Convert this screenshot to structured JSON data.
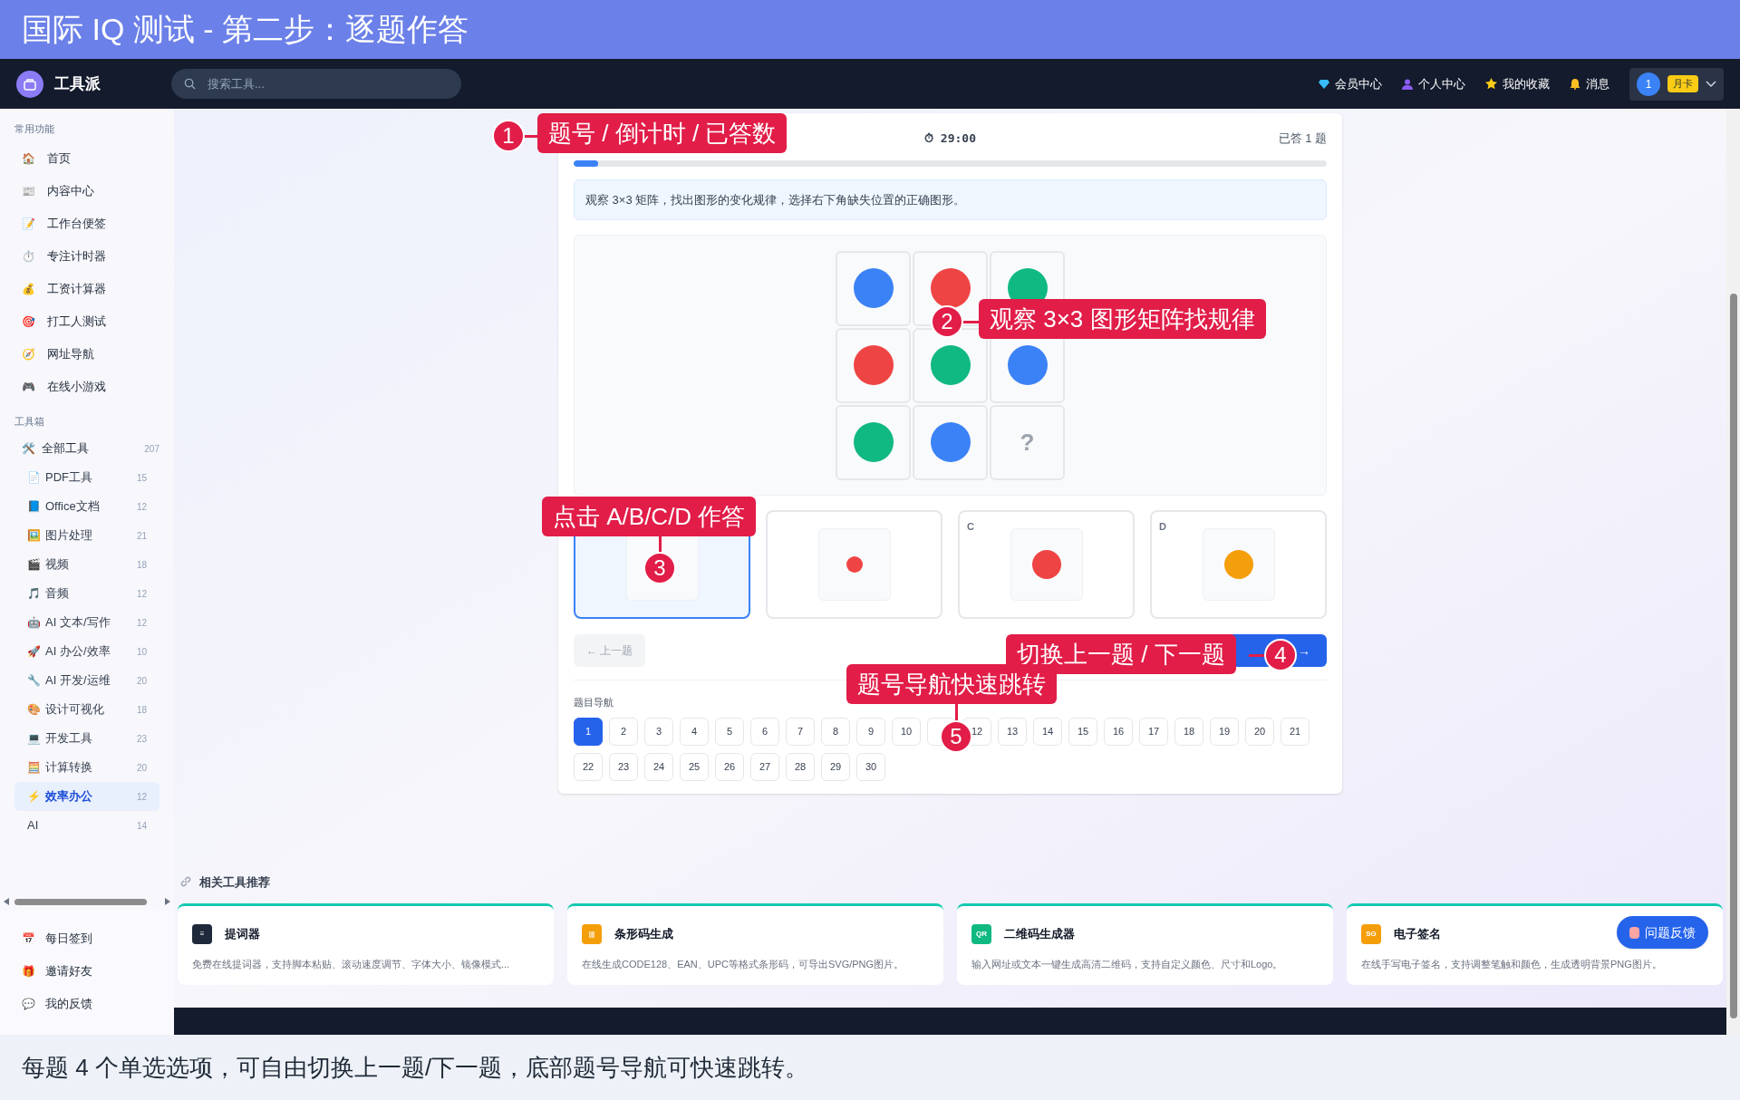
{
  "banner": {
    "title": "国际 IQ 测试 - 第二步：逐题作答"
  },
  "navbar": {
    "brand": "工具派",
    "search_placeholder": "搜索工具...",
    "links": [
      {
        "kind": "gem",
        "label": "会员中心"
      },
      {
        "kind": "user",
        "label": "个人中心"
      },
      {
        "kind": "star",
        "label": "我的收藏"
      },
      {
        "kind": "bell",
        "label": "消息"
      }
    ],
    "account": {
      "avatar": "1",
      "badge": "月卡"
    }
  },
  "sidebar": {
    "sections": [
      {
        "title": "常用功能",
        "items": [
          {
            "icon": "🏠",
            "label": "首页"
          },
          {
            "icon": "📰",
            "label": "内容中心"
          },
          {
            "icon": "📝",
            "label": "工作台便签"
          },
          {
            "icon": "⏱️",
            "label": "专注计时器"
          },
          {
            "icon": "💰",
            "label": "工资计算器"
          },
          {
            "icon": "🎯",
            "label": "打工人测试"
          },
          {
            "icon": "🧭",
            "label": "网址导航"
          },
          {
            "icon": "🎮",
            "label": "在线小游戏"
          }
        ]
      },
      {
        "title": "工具箱",
        "items": [
          {
            "icon": "🛠️",
            "label": "全部工具",
            "count": "207",
            "selected": false,
            "children": [
              {
                "icon": "📄",
                "label": "PDF工具",
                "count": "15",
                "selected": false
              },
              {
                "icon": "📘",
                "label": "Office文档",
                "count": "12",
                "selected": false
              },
              {
                "icon": "🖼️",
                "label": "图片处理",
                "count": "21",
                "selected": false
              },
              {
                "icon": "🎬",
                "label": "视频",
                "count": "18",
                "selected": false
              },
              {
                "icon": "🎵",
                "label": "音频",
                "count": "12",
                "selected": false
              },
              {
                "icon": "🤖",
                "label": "AI 文本/写作",
                "count": "12",
                "selected": false
              },
              {
                "icon": "🚀",
                "label": "AI 办公/效率",
                "count": "10",
                "selected": false
              },
              {
                "icon": "🔧",
                "label": "AI 开发/运维",
                "count": "20",
                "selected": false
              },
              {
                "icon": "🎨",
                "label": "设计可视化",
                "count": "18",
                "selected": false
              },
              {
                "icon": "💻",
                "label": "开发工具",
                "count": "23",
                "selected": false
              },
              {
                "icon": "🧮",
                "label": "计算转换",
                "count": "20",
                "selected": false
              },
              {
                "icon": "⚡",
                "label": "效率办公",
                "count": "12",
                "selected": true
              },
              {
                "label": "AI",
                "count": "14",
                "selected": false
              }
            ]
          }
        ]
      }
    ],
    "footer_items": [
      {
        "icon": "📅",
        "label": "每日签到"
      },
      {
        "icon": "🎁",
        "label": "邀请好友"
      },
      {
        "icon": "💬",
        "label": "我的反馈"
      }
    ]
  },
  "quiz": {
    "timer": "⏱ 29:00",
    "answered": "已答 1 题",
    "progress": {
      "level": 0.033
    },
    "instruction": "观察 3×3 矩阵，找出图形的变化规律，选择右下角缺失位置的正确图形。",
    "matrix": [
      {
        "kind": "circle",
        "color": "#3b82f6"
      },
      {
        "kind": "circle",
        "color": "#ef4444"
      },
      {
        "kind": "circle",
        "color": "#10b981"
      },
      {
        "kind": "circle",
        "color": "#ef4444"
      },
      {
        "kind": "circle",
        "color": "#10b981"
      },
      {
        "kind": "circle",
        "color": "#3b82f6"
      },
      {
        "kind": "circle",
        "color": "#10b981"
      },
      {
        "kind": "circle",
        "color": "#3b82f6"
      },
      {
        "kind": "missing",
        "text": "?"
      }
    ],
    "options": [
      {
        "selected": true
      },
      {
        "selected": false,
        "shape": {
          "kind": "dot",
          "color": "#ef4444"
        }
      },
      {
        "letter": "C",
        "selected": false,
        "shape": {
          "kind": "circle",
          "color": "#ef4444"
        }
      },
      {
        "letter": "D",
        "selected": false,
        "shape": {
          "kind": "circle",
          "color": "#f59e0b"
        }
      }
    ],
    "prev_button": {
      "label": "← 上一题",
      "disabled": true
    },
    "next_button": {
      "label": "→"
    },
    "nav_title": "题目导航",
    "nav": [
      {
        "label": "1",
        "selected": true
      },
      {
        "label": "2",
        "selected": false
      },
      {
        "label": "3",
        "selected": false
      },
      {
        "label": "4",
        "selected": false
      },
      {
        "label": "5",
        "selected": false
      },
      {
        "label": "6",
        "selected": false
      },
      {
        "label": "7",
        "selected": false
      },
      {
        "label": "8",
        "selected": false
      },
      {
        "label": "9",
        "selected": false
      },
      {
        "label": "10",
        "selected": false
      },
      {
        "selected": false
      },
      {
        "label": "12",
        "selected": false
      },
      {
        "label": "13",
        "selected": false
      },
      {
        "label": "14",
        "selected": false
      },
      {
        "label": "15",
        "selected": false
      },
      {
        "label": "16",
        "selected": false
      },
      {
        "label": "17",
        "selected": false
      },
      {
        "label": "18",
        "selected": false
      },
      {
        "label": "19",
        "selected": false
      },
      {
        "label": "20",
        "selected": false
      },
      {
        "label": "21",
        "selected": false
      },
      {
        "label": "22",
        "selected": false
      },
      {
        "label": "23",
        "selected": false
      },
      {
        "label": "24",
        "selected": false
      },
      {
        "label": "25",
        "selected": false
      },
      {
        "label": "26",
        "selected": false
      },
      {
        "label": "27",
        "selected": false
      },
      {
        "label": "28",
        "selected": false
      },
      {
        "label": "29",
        "selected": false
      },
      {
        "label": "30",
        "selected": false
      }
    ]
  },
  "related": {
    "title": "相关工具推荐",
    "cards": [
      {
        "icon_text": "≡",
        "color": "#1e293b",
        "name": "提词器",
        "desc": "免费在线提词器，支持脚本粘贴、滚动速度调节、字体大小、镜像模式..."
      },
      {
        "icon_text": "|||",
        "color": "#f59e0b",
        "name": "条形码生成",
        "desc": "在线生成CODE128、EAN、UPC等格式条形码，可导出SVG/PNG图片。"
      },
      {
        "icon_text": "QR",
        "color": "#10b981",
        "name": "二维码生成器",
        "desc": "输入网址或文本一键生成高清二维码，支持自定义颜色、尺寸和Logo。"
      },
      {
        "icon_text": "SG",
        "color": "#f59e0b",
        "name": "电子签名",
        "desc": "在线手写电子签名，支持调整笔触和颜色，生成透明背景PNG图片。"
      }
    ]
  },
  "feedback_button": "问题反馈",
  "callouts": [
    {
      "number": "1",
      "text": "题号 / 倒计时 / 已答数"
    },
    {
      "number": "2",
      "text": "观察 3×3 图形矩阵找规律"
    },
    {
      "number": "3",
      "text": "点击 A/B/C/D 作答"
    },
    {
      "number": "4",
      "text": "切换上一题 / 下一题"
    },
    {
      "number": "5",
      "text": "题号导航快速跳转"
    }
  ],
  "caption": "每题 4 个单选选项，可自由切换上一题/下一题，底部题号导航可快速跳转。"
}
